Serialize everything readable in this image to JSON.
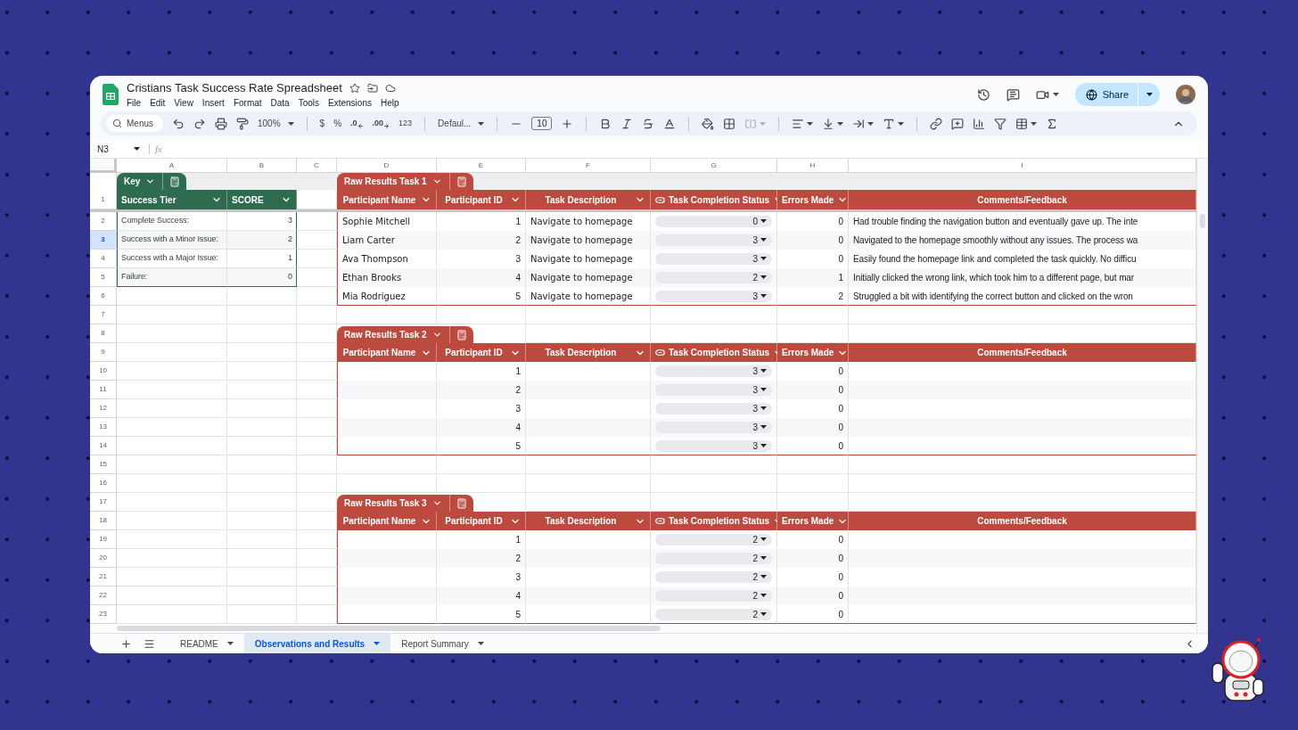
{
  "document": {
    "title": "Cristians Task Success Rate Spreadsheet"
  },
  "menu": [
    "File",
    "Edit",
    "View",
    "Insert",
    "Format",
    "Data",
    "Tools",
    "Extensions",
    "Help"
  ],
  "share": {
    "label": "Share"
  },
  "toolbar": {
    "search": "Menus",
    "zoom": "100%",
    "currency": "$",
    "percent": "%",
    "decrease_decimals": ".0",
    "increase_decimals": ".00",
    "number_format": "123",
    "font": "Defaul...",
    "font_size": "10"
  },
  "formula_bar": {
    "cell": "N3",
    "fx": "fx"
  },
  "columns": [
    "A",
    "B",
    "C",
    "D",
    "E",
    "F",
    "G",
    "H",
    "I"
  ],
  "rows": [
    {
      "label": "1",
      "selected": false
    },
    {
      "label": "2",
      "selected": false
    },
    {
      "label": "3",
      "selected": true
    },
    {
      "label": "4",
      "selected": false
    },
    {
      "label": "5",
      "selected": false
    },
    {
      "label": "6",
      "selected": false
    },
    {
      "label": "7",
      "selected": false
    },
    {
      "label": "8",
      "selected": false
    },
    {
      "label": "9",
      "selected": false
    },
    {
      "label": "10",
      "selected": false
    },
    {
      "label": "11",
      "selected": false
    },
    {
      "label": "12",
      "selected": false
    },
    {
      "label": "13",
      "selected": false
    },
    {
      "label": "14",
      "selected": false
    },
    {
      "label": "15",
      "selected": false
    },
    {
      "label": "16",
      "selected": false
    },
    {
      "label": "17",
      "selected": false
    },
    {
      "label": "18",
      "selected": false
    },
    {
      "label": "19",
      "selected": false
    },
    {
      "label": "20",
      "selected": false
    },
    {
      "label": "21",
      "selected": false
    },
    {
      "label": "22",
      "selected": false
    },
    {
      "label": "23",
      "selected": false
    }
  ],
  "key_table": {
    "name": "Key",
    "headers": [
      "Success Tier",
      "SCORE"
    ],
    "rows": [
      {
        "tier": "Complete Success:",
        "score": "3"
      },
      {
        "tier": "Success with a Minor Issue:",
        "score": "2"
      },
      {
        "tier": "Success with a Major Issue:",
        "score": "1"
      },
      {
        "tier": "Failure:",
        "score": "0"
      }
    ]
  },
  "result_tables": [
    {
      "name": "Raw Results Task 1",
      "headers": [
        "Participant Name",
        "Participant ID",
        "Task Description",
        "Task Completion Status",
        "Errors Made",
        "Comments/Feedback"
      ],
      "rows": [
        {
          "name": "Sophie Mitchell",
          "id": "1",
          "description": "Navigate to homepage",
          "status": "0",
          "errors": "0",
          "comment": "Had trouble finding the navigation button and eventually gave up. The inte"
        },
        {
          "name": "Liam Carter",
          "id": "2",
          "description": "Navigate to homepage",
          "status": "3",
          "errors": "0",
          "comment": "Navigated to the homepage smoothly without any issues. The process wa"
        },
        {
          "name": "Ava Thompson",
          "id": "3",
          "description": "Navigate to homepage",
          "status": "3",
          "errors": "0",
          "comment": "Easily found the homepage link and completed the task quickly. No difficu"
        },
        {
          "name": "Ethan Brooks",
          "id": "4",
          "description": "Navigate to homepage",
          "status": "2",
          "errors": "1",
          "comment": "Initially clicked the wrong link, which took him to a different page, but mar"
        },
        {
          "name": "Mia Rodriguez",
          "id": "5",
          "description": "Navigate to homepage",
          "status": "3",
          "errors": "2",
          "comment": "Struggled a bit with identifying the correct button and clicked on the wron"
        }
      ]
    },
    {
      "name": "Raw Results Task 2",
      "headers": [
        "Participant Name",
        "Participant ID",
        "Task Description",
        "Task Completion Status",
        "Errors Made",
        "Comments/Feedback"
      ],
      "rows": [
        {
          "id": "1",
          "status": "3",
          "errors": "0"
        },
        {
          "id": "2",
          "status": "3",
          "errors": "0"
        },
        {
          "id": "3",
          "status": "3",
          "errors": "0"
        },
        {
          "id": "4",
          "status": "3",
          "errors": "0"
        },
        {
          "id": "5",
          "status": "3",
          "errors": "0"
        }
      ]
    },
    {
      "name": "Raw Results Task 3",
      "headers": [
        "Participant Name",
        "Participant ID",
        "Task Description",
        "Task Completion Status",
        "Errors Made",
        "Comments/Feedback"
      ],
      "rows": [
        {
          "id": "1",
          "status": "2",
          "errors": "0"
        },
        {
          "id": "2",
          "status": "2",
          "errors": "0"
        },
        {
          "id": "3",
          "status": "2",
          "errors": "0"
        },
        {
          "id": "4",
          "status": "2",
          "errors": "0"
        },
        {
          "id": "5",
          "status": "2",
          "errors": "0"
        }
      ]
    }
  ],
  "sheet_tabs": [
    {
      "label": "README",
      "selected": false
    },
    {
      "label": "Observations and Results",
      "selected": true
    },
    {
      "label": "Report Summary",
      "selected": false
    }
  ]
}
